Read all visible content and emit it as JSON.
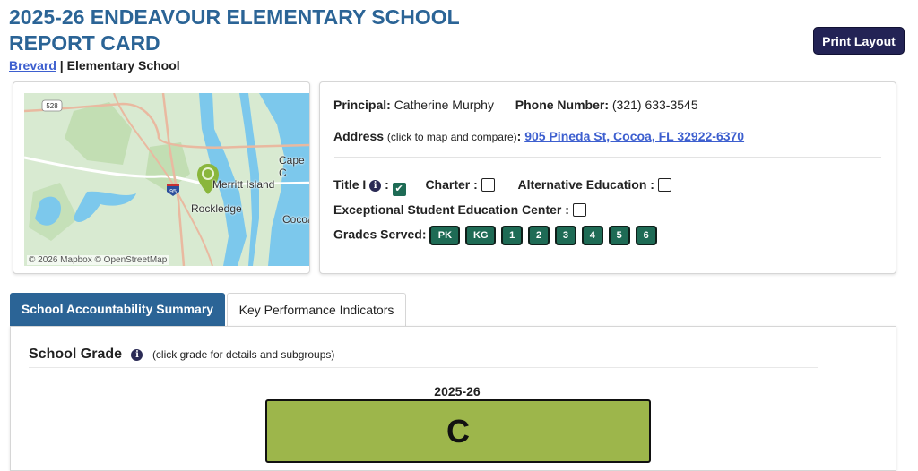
{
  "header": {
    "title": "2025-26 ENDEAVOUR ELEMENTARY SCHOOL REPORT CARD",
    "district_link": "Brevard",
    "separator": " | ",
    "school_type": "Elementary School",
    "print_button": "Print Layout"
  },
  "map": {
    "labels": [
      "Merritt Island",
      "Rockledge",
      "Cape C",
      "Cocoa"
    ],
    "road_shield_528": "528",
    "road_shield_95": "95",
    "attribution": "© 2026 Mapbox  © OpenStreetMap",
    "colors": {
      "land": "#d8ead1",
      "water": "#7cc8ec",
      "park": "#b9d8a6",
      "marker": "#8ab63c"
    }
  },
  "info": {
    "principal_label": "Principal:",
    "principal_name": "Catherine Murphy",
    "phone_label": "Phone Number:",
    "phone": "(321) 633-3545",
    "address_label": "Address",
    "address_hint": "(click to map and compare)",
    "address_colon": ":",
    "address": "905 Pineda St, Cocoa, FL 32922-6370",
    "title1_label": "Title I",
    "title1_checked": true,
    "charter_label": "Charter :",
    "charter_checked": false,
    "alt_ed_label": "Alternative Education :",
    "alt_ed_checked": false,
    "ese_label": "Exceptional Student Education Center :",
    "ese_checked": false,
    "grades_label": "Grades Served:",
    "grades": [
      "PK",
      "KG",
      "1",
      "2",
      "3",
      "4",
      "5",
      "6"
    ]
  },
  "tabs": [
    {
      "label": "School Accountability Summary",
      "active": true
    },
    {
      "label": "Key Performance Indicators",
      "active": false
    }
  ],
  "summary": {
    "heading": "School Grade",
    "hint": "(click grade for details and subgroups)",
    "year": "2025-26",
    "grade": "C",
    "grade_color": "#9db64b"
  }
}
